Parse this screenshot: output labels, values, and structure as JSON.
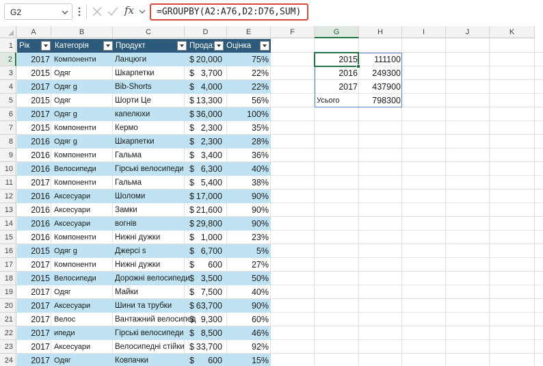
{
  "formula_bar": {
    "name_box": "G2",
    "formula": "=GROUPBY(A2:A76,D2:D76,SUM)",
    "fx_label": "fx"
  },
  "columns": [
    "A",
    "B",
    "C",
    "D",
    "E",
    "F",
    "G",
    "H",
    "I",
    "J",
    "K"
  ],
  "rows": [
    "1",
    "2",
    "3",
    "4",
    "5",
    "6",
    "7",
    "8",
    "9",
    "10",
    "11",
    "12",
    "13",
    "14",
    "15",
    "16",
    "17",
    "18",
    "19",
    "20",
    "21",
    "22",
    "23",
    "24"
  ],
  "table": {
    "headers": [
      "Рік",
      "Категорія",
      "Продукт",
      "Продажі",
      "Оцінка"
    ],
    "rows": [
      {
        "year": "2017",
        "category": "Компоненти",
        "product": "Ланцюги",
        "cur": "$",
        "sales": "20,000",
        "rating": "75%"
      },
      {
        "year": "2015",
        "category": "Одяг",
        "product": "Шкарпетки",
        "cur": "$",
        "sales": "3,700",
        "rating": "22%"
      },
      {
        "year": "2017",
        "category": "Одяг      g",
        "product": "Bib-Shorts",
        "cur": "$",
        "sales": "4,000",
        "rating": "22%"
      },
      {
        "year": "2015",
        "category": "Одяг",
        "product": "Шорти Це",
        "cur": "$",
        "sales": "13,300",
        "rating": "56%"
      },
      {
        "year": "2017",
        "category": "Одяг      g",
        "product": "капелюхи",
        "cur": "$",
        "sales": "36,000",
        "rating": "100%"
      },
      {
        "year": "2015",
        "category": "Компоненти",
        "product": "Кермо",
        "cur": "$",
        "sales": "2,300",
        "rating": "35%"
      },
      {
        "year": "2016",
        "category": "Одяг      g",
        "product": "Шкарпетки",
        "cur": "$",
        "sales": "2,300",
        "rating": "28%"
      },
      {
        "year": "2016",
        "category": "Компоненти",
        "product": "Гальма",
        "cur": "$",
        "sales": "3,400",
        "rating": "36%"
      },
      {
        "year": "2016",
        "category": "Велосипеди",
        "product": "Гірські велосипеди",
        "cur": "$",
        "sales": "6,300",
        "rating": "40%"
      },
      {
        "year": "2017",
        "category": "Компоненти",
        "product": "Гальма",
        "cur": "$",
        "sales": "5,400",
        "rating": "38%"
      },
      {
        "year": "2016",
        "category": "Аксесуари",
        "product": "Шоломи",
        "cur": "$",
        "sales": "17,000",
        "rating": "90%"
      },
      {
        "year": "2016",
        "category": "Аксесуари",
        "product": "Замки",
        "cur": "$",
        "sales": "21,600",
        "rating": "90%"
      },
      {
        "year": "2016",
        "category": "Аксесуари",
        "product": "вогнів",
        "cur": "$",
        "sales": "29,800",
        "rating": "90%"
      },
      {
        "year": "2016",
        "category": "Компоненти",
        "product": "Нижні дужки",
        "cur": "$",
        "sales": "1,000",
        "rating": "23%"
      },
      {
        "year": "2015",
        "category": "Одяг      g",
        "product": "Джерсі s",
        "cur": "$",
        "sales": "6,700",
        "rating": "5%"
      },
      {
        "year": "2017",
        "category": "Компоненти",
        "product": "Нижні дужки",
        "cur": "$",
        "sales": "600",
        "rating": "27%"
      },
      {
        "year": "2015",
        "category": "Велосипеди",
        "product": "Дорожні велосипеди",
        "cur": "$",
        "sales": "3,500",
        "rating": "50%"
      },
      {
        "year": "2017",
        "category": "Одяг",
        "product": "Майки",
        "cur": "$",
        "sales": "7,500",
        "rating": "40%"
      },
      {
        "year": "2017",
        "category": "Аксесуари",
        "product": "Шини та трубки",
        "cur": "$",
        "sales": "63,700",
        "rating": "90%"
      },
      {
        "year": "2017",
        "category": "Велос",
        "product": "Вантажний велосипед",
        "cur": "$",
        "sales": "9,300",
        "rating": "60%"
      },
      {
        "year": "2017",
        "category": "ипеди",
        "product": "Гірські велосипеди",
        "cur": "$",
        "sales": "8,500",
        "rating": "46%"
      },
      {
        "year": "2017",
        "category": "Аксесуари",
        "product": "Велосипедні стійки",
        "cur": "$",
        "sales": "33,700",
        "rating": "92%"
      },
      {
        "year": "2017",
        "category": "Одяг",
        "product": "Ковпачки",
        "cur": "$",
        "sales": "600",
        "rating": "15%"
      }
    ]
  },
  "groupby_result": [
    {
      "label": "2015",
      "value": "111100"
    },
    {
      "label": "2016",
      "value": "249300"
    },
    {
      "label": "2017",
      "value": "437900"
    },
    {
      "label": "Усього",
      "value": "798300"
    }
  ],
  "colors": {
    "header_fill": "#2d5a7a",
    "band_fill": "#bfe3f2",
    "formula_highlight": "#d9453b",
    "selection": "#207245",
    "result_border": "#5b7fd0"
  }
}
